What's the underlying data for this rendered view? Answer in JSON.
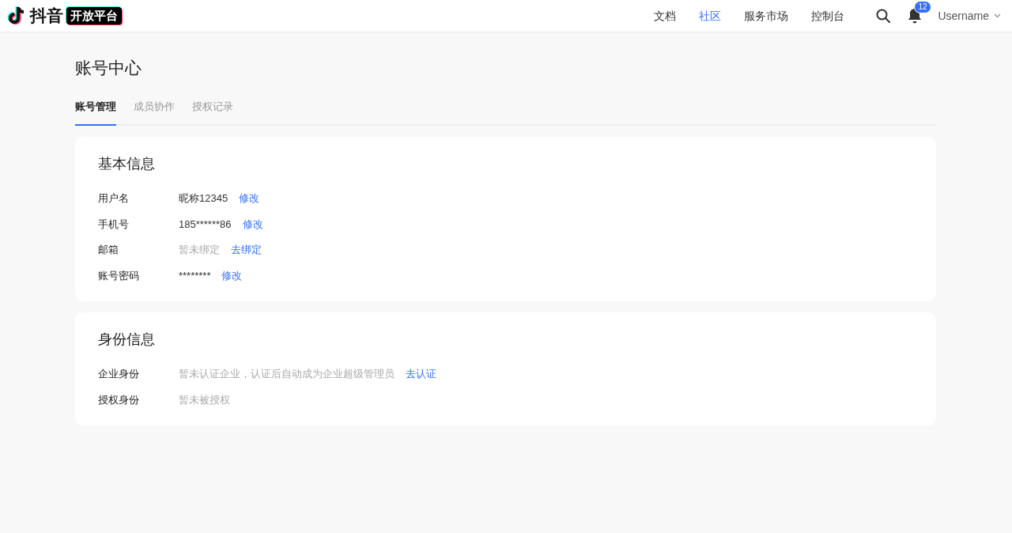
{
  "header": {
    "logo_text": "抖音",
    "logo_badge": "开放平台",
    "nav": [
      {
        "label": "文档",
        "selected": false
      },
      {
        "label": "社区",
        "selected": true
      },
      {
        "label": "服务市场",
        "selected": false
      },
      {
        "label": "控制台",
        "selected": false
      }
    ],
    "notification_count": "12",
    "username": "Username"
  },
  "page_title": "账号中心",
  "tabs": [
    {
      "label": "账号管理",
      "selected": true
    },
    {
      "label": "成员协作",
      "selected": false
    },
    {
      "label": "授权记录",
      "selected": false
    }
  ],
  "sections": [
    {
      "title": "基本信息",
      "rows": [
        {
          "label": "用户名",
          "value": "昵称12345",
          "empty": false,
          "action": "修改"
        },
        {
          "label": "手机号",
          "value": "185******86",
          "empty": false,
          "action": "修改"
        },
        {
          "label": "邮箱",
          "value": "暂未绑定",
          "empty": true,
          "action": "去绑定"
        },
        {
          "label": "账号密码",
          "value": "********",
          "empty": false,
          "action": "修改"
        }
      ]
    },
    {
      "title": "身份信息",
      "rows": [
        {
          "label": "企业身份",
          "value": "暂未认证企业，认证后自动成为企业超级管理员",
          "empty": true,
          "action": "去认证"
        },
        {
          "label": "授权身份",
          "value": "暂未被授权",
          "empty": true
        }
      ]
    }
  ]
}
